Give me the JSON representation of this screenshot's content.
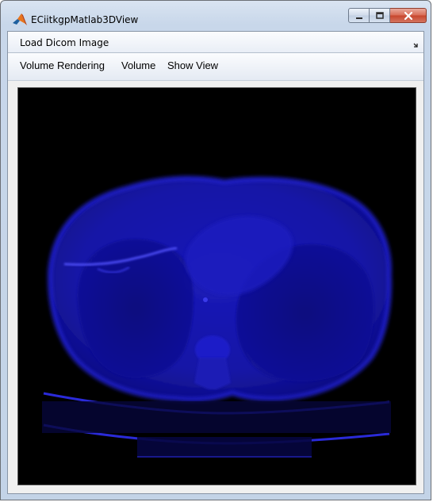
{
  "window": {
    "title": "ECiitkgpMatlab3DView",
    "icon": "matlab-icon"
  },
  "toolbar": {
    "load_label": "Load Dicom Image",
    "overflow_icon": "chevron-expand-icon"
  },
  "menu": {
    "items": [
      {
        "label": "Volume Rendering"
      },
      {
        "label": "Volume"
      },
      {
        "label": "Show View"
      }
    ]
  },
  "viewer": {
    "content": "ct-axial-volume-render",
    "colors": {
      "background": "#000000",
      "tissue": "#1a1ad0"
    }
  }
}
